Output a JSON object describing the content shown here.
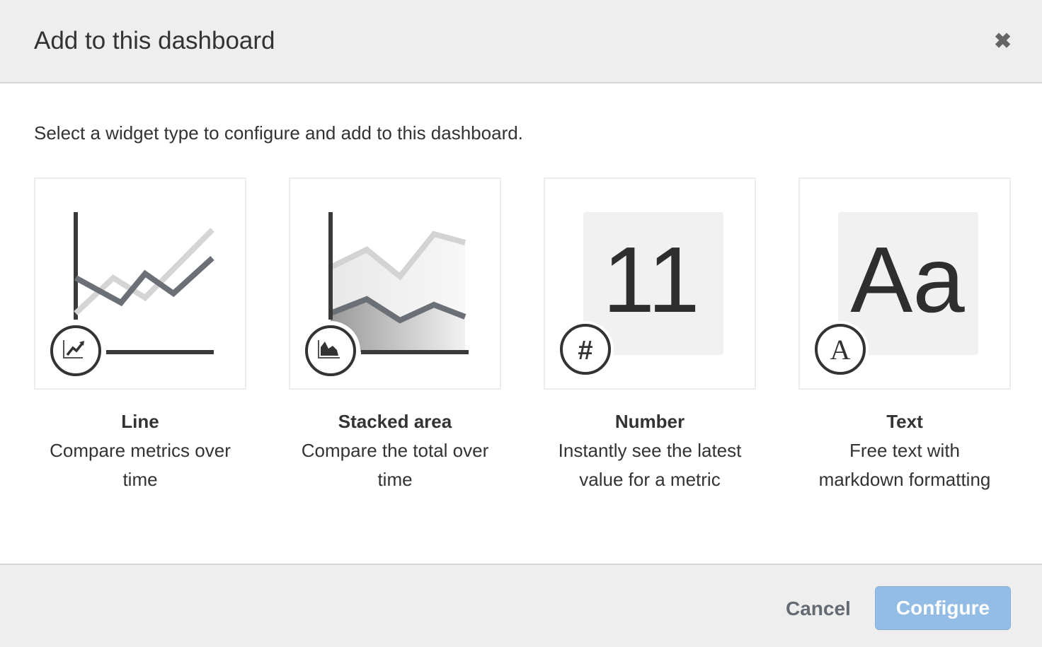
{
  "dialog": {
    "title": "Add to this dashboard",
    "close_icon": "close-icon",
    "intro": "Select a widget type to configure and add to this dashboard."
  },
  "widgets": [
    {
      "name": "Line",
      "description_1": "Compare metrics over",
      "description_2": "time",
      "icon": "line-chart-icon"
    },
    {
      "name": "Stacked area",
      "description_1": "Compare the total over",
      "description_2": "time",
      "icon": "area-chart-icon"
    },
    {
      "name": "Number",
      "description_1": "Instantly see the latest",
      "description_2": "value for a metric",
      "icon": "hash-icon",
      "preview": "11",
      "badge": "#"
    },
    {
      "name": "Text",
      "description_1": "Free text with",
      "description_2": "markdown formatting",
      "icon": "font-icon",
      "preview": "Aa",
      "badge": "A"
    }
  ],
  "footer": {
    "cancel": "Cancel",
    "configure": "Configure"
  },
  "colors": {
    "primary_button": "#93bde4",
    "dark": "#333333",
    "series": "#6b7077"
  }
}
